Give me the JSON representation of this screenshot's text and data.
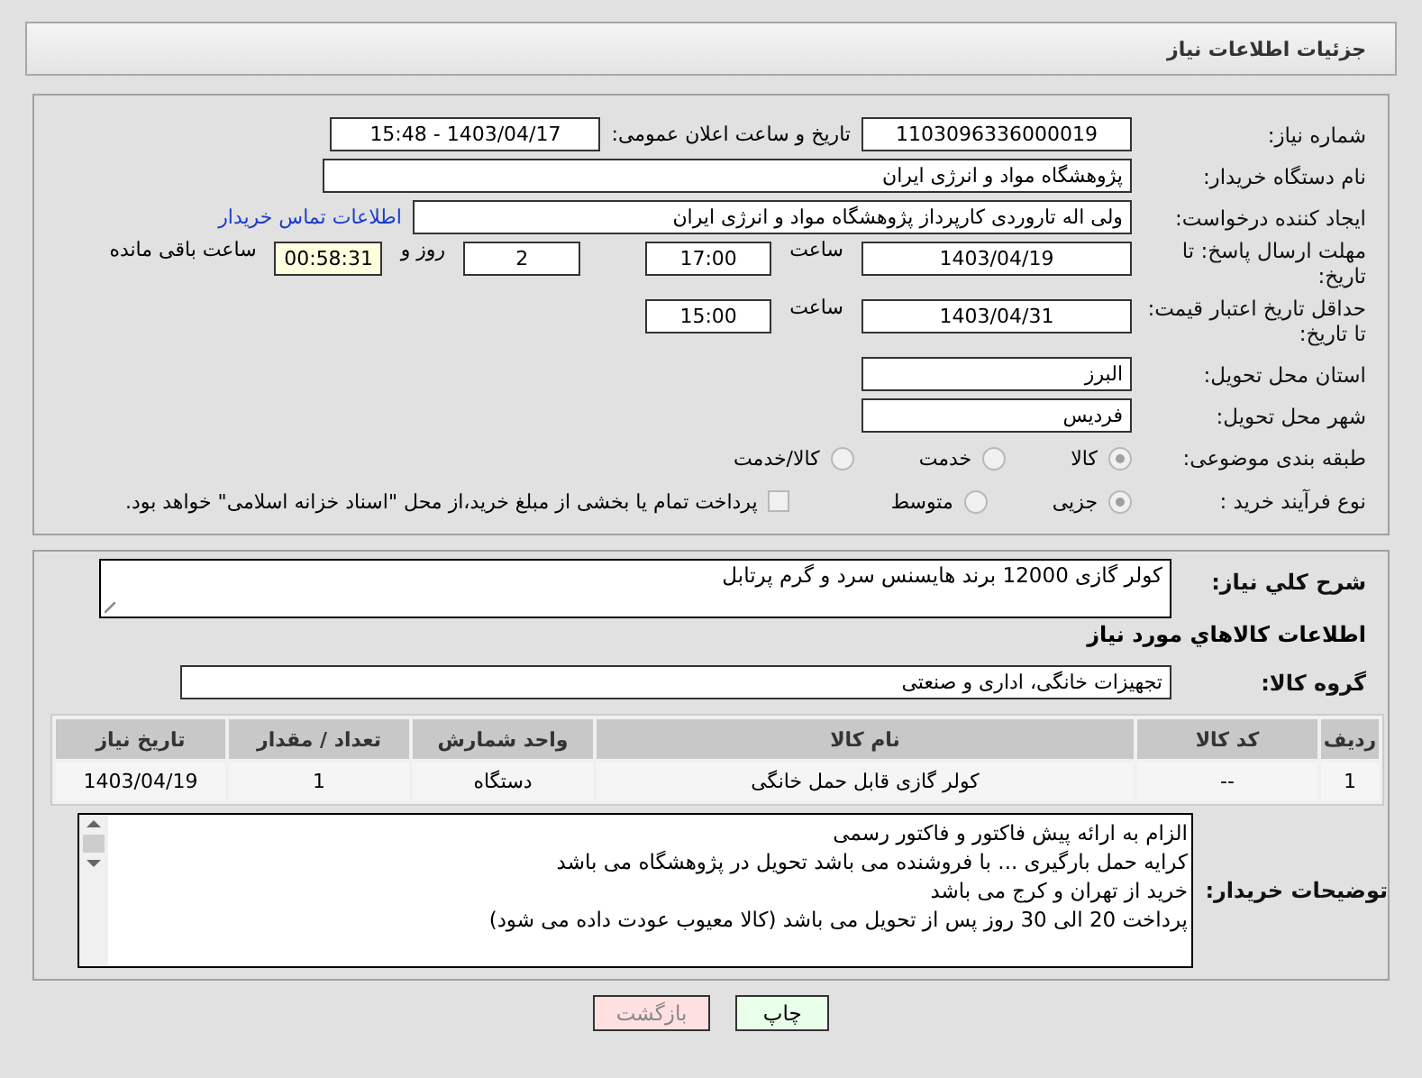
{
  "header": {
    "title": "جزئیات اطلاعات نیاز"
  },
  "need_number": {
    "label": "شماره نیاز:",
    "value": "1103096336000019"
  },
  "announce": {
    "label": "تاریخ و ساعت اعلان عمومی:",
    "value": "1403/04/17 - 15:48"
  },
  "buyer_org": {
    "label": "نام دستگاه خریدار:",
    "value": "پژوهشگاه مواد و انرژی ایران"
  },
  "requester": {
    "label": "ایجاد کننده درخواست:",
    "value": "ولی اله تاروردی کارپرداز پژوهشگاه مواد و انرژی ایران",
    "link": "اطلاعات تماس خریدار"
  },
  "reply_deadline": {
    "label": "مهلت ارسال پاسخ: تا تاریخ:",
    "date": "1403/04/19",
    "time_label": "ساعت",
    "time": "17:00",
    "days": "2",
    "days_label": "روز و",
    "remaining": "00:58:31",
    "remaining_label": "ساعت باقی مانده"
  },
  "price_validity": {
    "label": "حداقل تاریخ اعتبار قیمت: تا تاریخ:",
    "date": "1403/04/31",
    "time_label": "ساعت",
    "time": "15:00"
  },
  "province": {
    "label": "استان محل تحویل:",
    "value": "البرز"
  },
  "city": {
    "label": "شهر محل تحویل:",
    "value": "فردیس"
  },
  "category": {
    "label": "طبقه بندی موضوعی:",
    "options": [
      {
        "label": "کالا",
        "selected": true
      },
      {
        "label": "خدمت",
        "selected": false
      },
      {
        "label": "کالا/خدمت",
        "selected": false
      }
    ]
  },
  "purchase_process": {
    "label": "نوع فرآیند خرید :",
    "options": [
      {
        "label": "جزیی",
        "selected": true
      },
      {
        "label": "متوسط",
        "selected": false
      }
    ],
    "payment_option": {
      "label": "پرداخت تمام یا بخشی از مبلغ خرید،از محل \"اسناد خزانه اسلامی\" خواهد بود.",
      "checked": false
    }
  },
  "description": {
    "label": "شرح کلي نیاز:",
    "value": "کولر گازی 12000 برند هایسنس سرد و گرم پرتابل"
  },
  "goods_heading": "اطلاعات کالاهاي مورد نیاز",
  "goods_group": {
    "label": "گروه کالا:",
    "value": "تجهیزات خانگی، اداری و صنعتی"
  },
  "table": {
    "columns": [
      "ردیف",
      "کد کالا",
      "نام کالا",
      "واحد شمارش",
      "تعداد / مقدار",
      "تاریخ نیاز"
    ],
    "rows": [
      [
        "1",
        "--",
        "کولر گازی قابل حمل خانگی",
        "دستگاه",
        "1",
        "1403/04/19"
      ]
    ]
  },
  "buyer_notes": {
    "label": "توضیحات خریدار:",
    "lines": [
      "الزام به ارائه پیش فاکتور و فاکتور رسمی",
      "کرایه حمل بارگیری ... با فروشنده می باشد تحویل در پژوهشگاه می باشد",
      "خرید از تهران و کرج می باشد",
      "پرداخت 20 الی 30 روز پس از تحویل می باشد (کالا معیوب عودت داده می شود)"
    ]
  },
  "buttons": [
    {
      "label": "چاپ",
      "kind": "print"
    },
    {
      "label": "بازگشت",
      "kind": "back"
    }
  ]
}
